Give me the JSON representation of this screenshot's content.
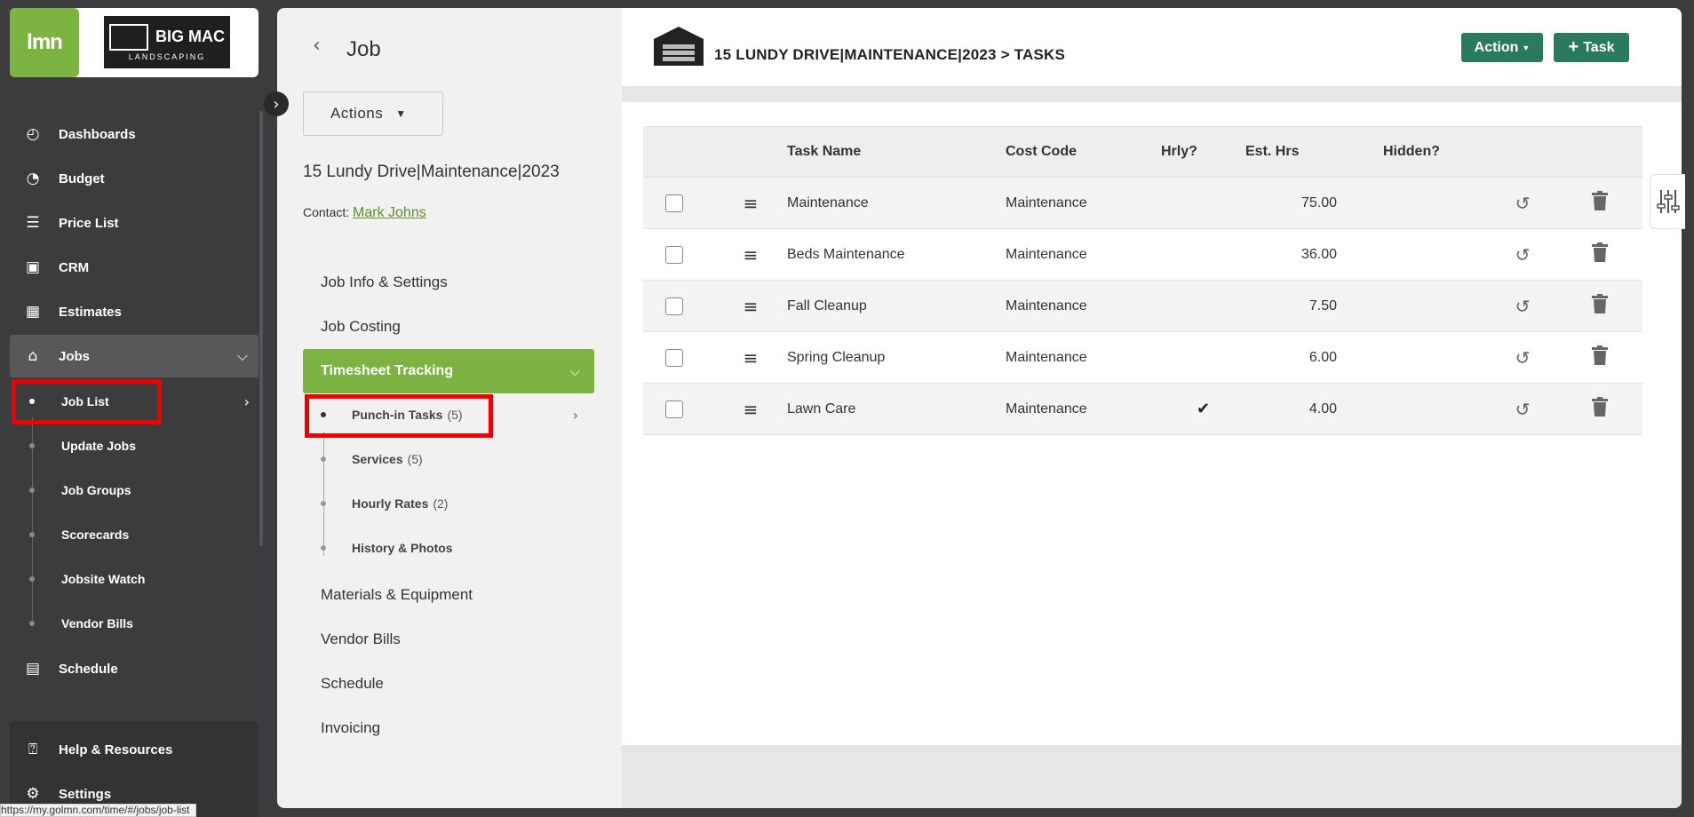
{
  "brand": {
    "lmn_logo": "lmn",
    "company_name": "BIG MAC",
    "company_sub": "LANDSCAPING"
  },
  "nav": {
    "items": [
      {
        "label": "Dashboards",
        "icon": "gauge-icon",
        "glyph": "◴"
      },
      {
        "label": "Budget",
        "icon": "pie-chart-icon",
        "glyph": "◔"
      },
      {
        "label": "Price List",
        "icon": "list-icon",
        "glyph": "☰"
      },
      {
        "label": "CRM",
        "icon": "contact-card-icon",
        "glyph": "▣"
      },
      {
        "label": "Estimates",
        "icon": "calculator-icon",
        "glyph": "▦"
      },
      {
        "label": "Jobs",
        "icon": "garage-icon",
        "glyph": "⌂"
      }
    ],
    "jobs_sub": [
      {
        "label": "Job List"
      },
      {
        "label": "Update Jobs"
      },
      {
        "label": "Job Groups"
      },
      {
        "label": "Scorecards"
      },
      {
        "label": "Jobsite Watch"
      },
      {
        "label": "Vendor Bills"
      }
    ],
    "schedule": {
      "label": "Schedule",
      "glyph": "▤"
    },
    "help": {
      "label": "Help & Resources",
      "glyph": "⍰"
    },
    "settings": {
      "label": "Settings",
      "glyph": "⚙"
    }
  },
  "status_url": "https://my.golmn.com/time/#/jobs/job-list",
  "job_panel": {
    "heading": "Job",
    "actions_label": "Actions",
    "job_title": "15 Lundy Drive|Maintenance|2023",
    "contact_label": "Contact:",
    "contact_name": "Mark Johns",
    "menu": [
      "Job Info & Settings",
      "Job Costing"
    ],
    "timesheet_tab": "Timesheet Tracking",
    "timesheet_sub": [
      {
        "label": "Punch-in Tasks",
        "count": "(5)"
      },
      {
        "label": "Services",
        "count": "(5)"
      },
      {
        "label": "Hourly Rates",
        "count": "(2)"
      },
      {
        "label": "History & Photos",
        "count": ""
      }
    ],
    "menu_bottom": [
      "Materials & Equipment",
      "Vendor Bills",
      "Schedule",
      "Invoicing"
    ]
  },
  "main": {
    "breadcrumb": "15 LUNDY DRIVE|MAINTENANCE|2023 > TASKS",
    "action_btn": "Action",
    "task_btn": "Task",
    "table": {
      "headers": [
        "Task Name",
        "Cost Code",
        "Hrly?",
        "Est. Hrs",
        "Hidden?"
      ],
      "rows": [
        {
          "name": "Maintenance",
          "code": "Maintenance",
          "hrly": "",
          "hrs": "75.00"
        },
        {
          "name": "Beds Maintenance",
          "code": "Maintenance",
          "hrly": "",
          "hrs": "36.00"
        },
        {
          "name": "Fall Cleanup",
          "code": "Maintenance",
          "hrly": "",
          "hrs": "7.50"
        },
        {
          "name": "Spring Cleanup",
          "code": "Maintenance",
          "hrly": "",
          "hrs": "6.00"
        },
        {
          "name": "Lawn Care",
          "code": "Maintenance",
          "hrly": "✔",
          "hrs": "4.00"
        }
      ]
    }
  },
  "colors": {
    "green": "#7cb342",
    "teal": "#2a7a5e",
    "nav_bg": "#3c3c3e",
    "highlight": "#ee0000"
  }
}
